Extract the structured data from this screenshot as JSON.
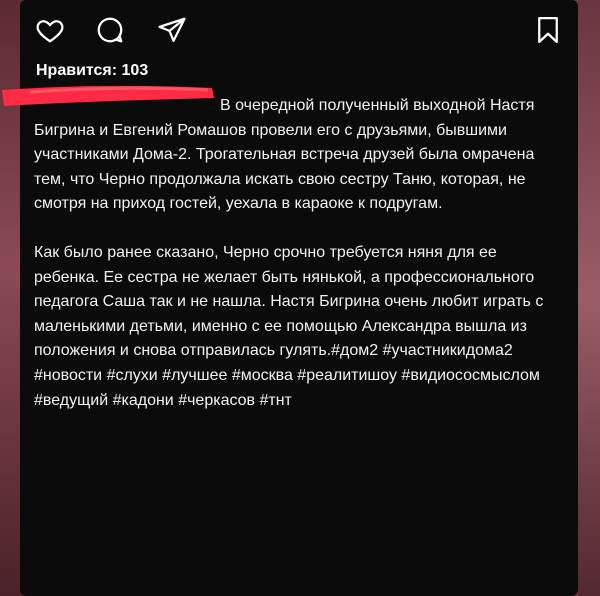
{
  "post": {
    "likes_text": "Нравится: 103",
    "caption_line1": "В очередной полученный выходной",
    "caption_p1_rest": "Настя Бигрина и Евгений Ромашов провели его с друзьями, бывшими участниками Дома-2. Трогательная встреча друзей была омрачена тем, что Черно продолжала искать свою сестру Таню, которая, не смотря на приход гостей, уехала в караоке к подругам.",
    "caption_p2": "Как было ранее сказано, Черно срочно требуется няня для ее ребенка. Ее сестра не желает быть нянькой, а профессионального педагога Саша так и не нашла. Настя Бигрина очень любит играть с маленькими детьми, именно с ее помощью Александра вышла из положения и снова отправилась гулять.#дом2 #участникидома2 #новости #слухи #лучшее #москва #реалитишоу #видиососмыслом #ведущий #кадони #черкасов #тнт"
  },
  "icons": {
    "like": "heart-icon",
    "comment": "comment-icon",
    "share": "send-icon",
    "save": "bookmark-icon"
  },
  "colors": {
    "background": "#0b0b0c",
    "text": "#f2f2f2",
    "scribble": "#ff2a43"
  }
}
